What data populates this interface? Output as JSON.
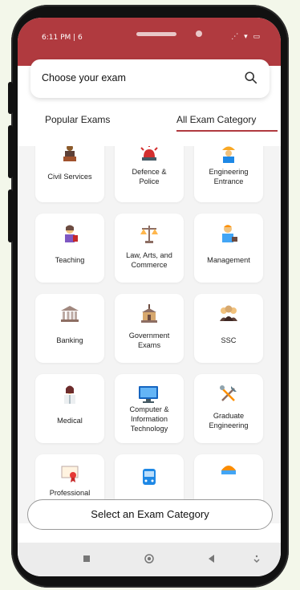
{
  "status": {
    "time": "6:11 PM | 6",
    "icons": "⋰ ▾ ▭"
  },
  "header": {
    "title": "Choose your exam"
  },
  "tabs": [
    {
      "label": "Popular Exams"
    },
    {
      "label": "All Exam Category"
    }
  ],
  "categories": [
    {
      "label1": "Civil Services",
      "label2": "",
      "icon": "civil-services-icon"
    },
    {
      "label1": "Defence &",
      "label2": "Police",
      "icon": "siren-icon"
    },
    {
      "label1": "Engineering",
      "label2": "Entrance",
      "icon": "engineer-icon"
    },
    {
      "label1": "Teaching",
      "label2": "",
      "icon": "teacher-icon"
    },
    {
      "label1": "Law, Arts, and",
      "label2": "Commerce",
      "icon": "scales-icon"
    },
    {
      "label1": "Management",
      "label2": "",
      "icon": "manager-icon"
    },
    {
      "label1": "Banking",
      "label2": "",
      "icon": "bank-icon"
    },
    {
      "label1": "Government",
      "label2": "Exams",
      "icon": "government-building-icon"
    },
    {
      "label1": "SSC",
      "label2": "",
      "icon": "group-icon"
    },
    {
      "label1": "Medical",
      "label2": "",
      "icon": "doctor-icon"
    },
    {
      "label1": "Computer &",
      "label2": "Information",
      "label3": "Technology",
      "icon": "computer-icon"
    },
    {
      "label1": "Graduate",
      "label2": "Engineering",
      "icon": "tools-icon"
    },
    {
      "label1": "Professional",
      "label2": "",
      "icon": "certificate-icon"
    },
    {
      "label1": "",
      "label2": "",
      "icon": "bus-icon"
    },
    {
      "label1": "",
      "label2": "",
      "icon": "dome-icon"
    }
  ],
  "cta": {
    "label": "Select an Exam Category"
  },
  "colors": {
    "accent": "#b03a3f",
    "background": "#f3f7ea"
  }
}
